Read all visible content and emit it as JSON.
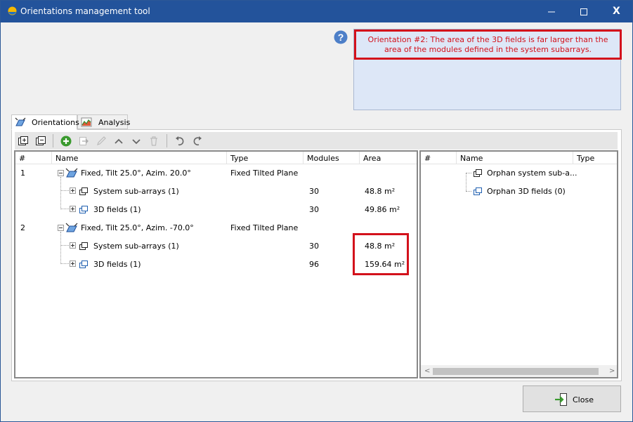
{
  "window": {
    "title": "Orientations management tool",
    "close_glyph": "X"
  },
  "warning": {
    "text": "Orientation #2: The area of the 3D fields is far larger than the area of the modules defined in the system subarrays.",
    "color": "#d3111b"
  },
  "tabs": [
    {
      "label": "Orientations",
      "icon": "orientation-icon",
      "active": true
    },
    {
      "label": "Analysis",
      "icon": "analysis-chart-icon",
      "active": false
    }
  ],
  "toolbar": {
    "buttons": [
      "expand-all-icon",
      "collapse-all-icon",
      "add-icon",
      "move-icon",
      "edit-icon",
      "move-up-icon",
      "move-down-icon",
      "delete-icon",
      "undo-icon",
      "redo-icon"
    ]
  },
  "left_table": {
    "columns": [
      "#",
      "Name",
      "Type",
      "Modules",
      "Area"
    ],
    "rows": [
      {
        "num": "1",
        "name": "Fixed, Tilt 25.0°, Azim. 20.0°",
        "type": "Fixed Tilted Plane",
        "modules": "",
        "area": ""
      },
      {
        "num": "",
        "name": "System sub-arrays (1)",
        "type": "",
        "modules": "30",
        "area": "48.8 m²"
      },
      {
        "num": "",
        "name": "3D fields (1)",
        "type": "",
        "modules": "30",
        "area": "49.86 m²"
      },
      {
        "num": "2",
        "name": "Fixed, Tilt 25.0°, Azim. -70.0°",
        "type": "Fixed Tilted Plane",
        "modules": "",
        "area": ""
      },
      {
        "num": "",
        "name": "System sub-arrays (1)",
        "type": "",
        "modules": "30",
        "area": "48.8 m²"
      },
      {
        "num": "",
        "name": "3D fields (1)",
        "type": "",
        "modules": "96",
        "area": "159.64 m²"
      }
    ]
  },
  "right_table": {
    "columns": [
      "#",
      "Name",
      "Type"
    ],
    "rows": [
      {
        "name": "Orphan system sub-a..."
      },
      {
        "name": "Orphan 3D fields (0)"
      }
    ],
    "scroll_left": "<",
    "scroll_right": ">"
  },
  "close_button": {
    "label": "Close"
  }
}
